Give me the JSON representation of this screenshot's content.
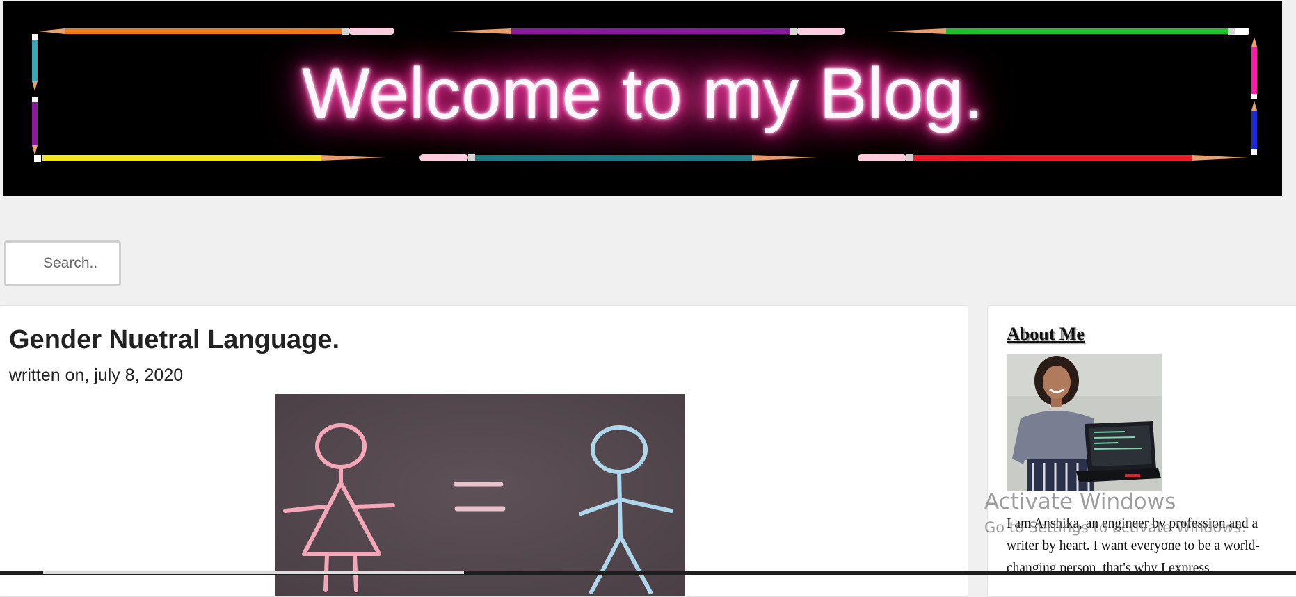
{
  "banner": {
    "title": "Welcome to my Blog.",
    "glow_color": "#ff3aa7",
    "pencil_colors": [
      "#f07a1a",
      "#8a1aa0",
      "#1fc02a",
      "#ff1aa8",
      "#1a2ad8",
      "#ec1c24",
      "#1a7c86",
      "#f2e61a",
      "#8a1aa0",
      "#39a6b6"
    ]
  },
  "search": {
    "placeholder": "Search.."
  },
  "post": {
    "title": "Gender Nuetral Language.",
    "date": "written on, july 8, 2020",
    "image_icon": "chalkboard-gender-equality-image"
  },
  "sidebar": {
    "heading": "About Me",
    "photo_icon": "profile-photo",
    "bio": "I am Anshika, an engineer by profession and a writer by heart. I want everyone to be a world-changing person, that's why I express"
  },
  "watermark": {
    "title": "Activate Windows",
    "subtitle": "Go to Settings to activate Windows."
  }
}
